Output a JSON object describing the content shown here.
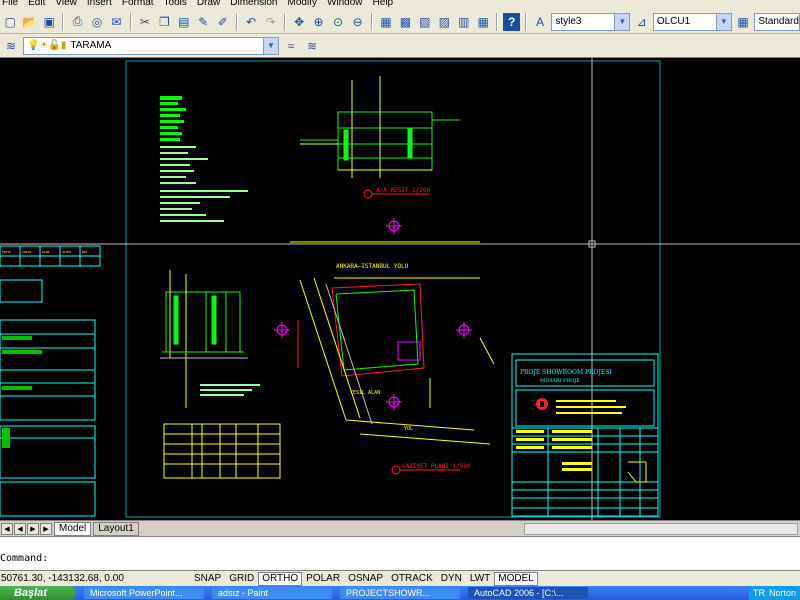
{
  "menu": [
    "File",
    "Edit",
    "View",
    "Insert",
    "Format",
    "Tools",
    "Draw",
    "Dimension",
    "Modify",
    "Window",
    "Help"
  ],
  "toolbar": {
    "text_style": "style3",
    "dim_style": "OLCU1",
    "table_style": "Standard"
  },
  "layers": {
    "current_layer": "TARAMA"
  },
  "drawing": {
    "annotations": {
      "road_label": "ANKARA–ISTANBUL YOLU",
      "yield_label": "YOL",
      "area_label": "YESIL ALAN",
      "scale_top": "A-A KESIT 1/200",
      "scale_bottom": "VAZIYET PLANI 1/500"
    },
    "title_block": {
      "project": "PROJE SHOWROOM PROJESI",
      "sub": "MIMARI PROJE"
    },
    "left_table_header": [
      "PAFTA",
      "TARIH",
      "ALAN",
      "OLCEK",
      "NOT"
    ]
  },
  "tabs": {
    "model": "Model",
    "layout1": "Layout1"
  },
  "command": {
    "prompt": "Command:"
  },
  "status": {
    "coords": "50761.30, -143132.68, 0.00",
    "buttons": [
      "SNAP",
      "GRID",
      "ORTHO",
      "POLAR",
      "OSNAP",
      "OTRACK",
      "DYN",
      "LWT",
      "MODEL"
    ]
  },
  "taskbar": {
    "start": "Başlat",
    "tasks": [
      "Microsoft PowerPoint...",
      "adsız - Paint",
      "PROJECTSHOWR...",
      "AutoCAD 2006 - [C:\\..."
    ],
    "tray_lang": "TR",
    "norton": "Norton"
  },
  "colors": {
    "drawing_bg": "#000000",
    "paper_border": "#00a0a0",
    "green": "#00ff00",
    "yellow": "#ffff00",
    "cyan": "#00ffff",
    "red": "#ff2020",
    "magenta": "#ff00ff"
  }
}
